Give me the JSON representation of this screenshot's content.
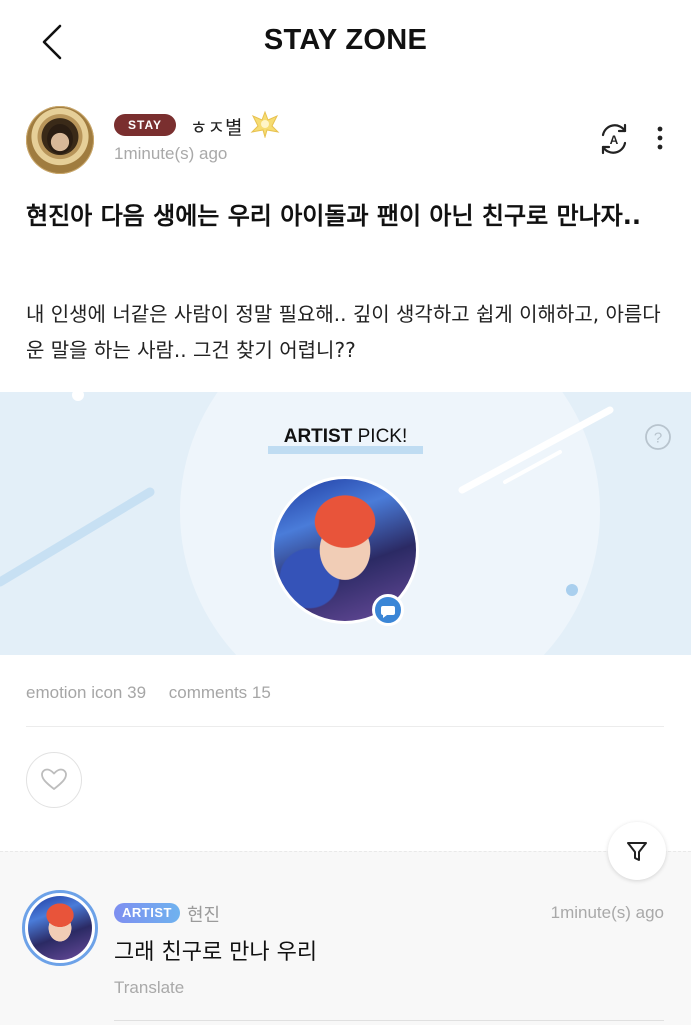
{
  "header": {
    "title": "STAY ZONE",
    "back_icon": "chevron-left-icon"
  },
  "post": {
    "author": {
      "badge": "STAY",
      "name": "ㅎㅈ별",
      "name_decoration_icon": "crown-icon",
      "time": "1minute(s) ago"
    },
    "actions": {
      "translate_icon": "translate-icon",
      "more_icon": "more-vertical-icon"
    },
    "title": "현진아 다음 생에는 우리 아이돌과 팬이 아닌 친구로 만나자..",
    "body": "내 인생에 너같은 사람이 정말 필요해.. 깊이 생각하고 쉽게 이해하고, 아름다운 말을 하는 사람.. 그건 찾기 어렵니??"
  },
  "artist_pick": {
    "title_bold": "ARTIST",
    "title_rest": " PICK!",
    "help_icon": "question-icon",
    "chat_icon": "chat-bubble-icon"
  },
  "stats": {
    "emotion": "emotion icon 39",
    "comments": "comments 15"
  },
  "like_icon": "heart-icon",
  "filter_icon": "filter-icon",
  "comment": {
    "badge": "ARTIST",
    "author": "현진",
    "time": "1minute(s) ago",
    "text": "그래 친구로 만나 우리",
    "translate": "Translate"
  },
  "colors": {
    "banner_bg": "#e3eff8",
    "stay_badge": "#7a2f2f",
    "artist_badge": "#7e8ff0",
    "chat_icon": "#3b86d6"
  }
}
